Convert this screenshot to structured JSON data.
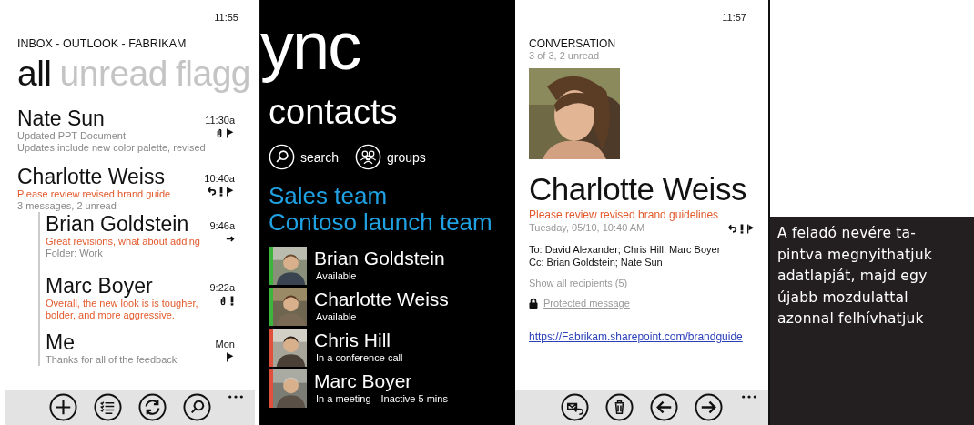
{
  "inbox": {
    "time": "11:55",
    "title": "INBOX - OUTLOOK - FABRIKAM",
    "pivots": [
      {
        "label": "all",
        "selected": true
      },
      {
        "label": "unread",
        "selected": false
      },
      {
        "label": "flagg",
        "selected": false
      }
    ],
    "messages": [
      {
        "sender": "Nate Sun",
        "time": "11:30a",
        "lines": [
          {
            "text": "Updated PPT Document",
            "unread": false
          },
          {
            "text": "Updates include new color palette, revised",
            "unread": false
          }
        ],
        "attachment": true,
        "important": false,
        "replied": false,
        "forwarded": false,
        "flagged": true
      },
      {
        "sender": "Charlotte Weiss",
        "time": "10:40a",
        "lines": [
          {
            "text": "Please review revised brand guide",
            "unread": true
          },
          {
            "text": "3 messages, 2 unread",
            "unread": false
          }
        ],
        "attachment": false,
        "important": true,
        "replied": true,
        "forwarded": false,
        "flagged": true,
        "children": [
          {
            "sender": "Brian Goldstein",
            "time": "9:46a",
            "lines": [
              {
                "text": "Great revisions, what about adding",
                "unread": true
              },
              {
                "text": "Folder: Work",
                "unread": false
              }
            ],
            "attachment": false,
            "important": false,
            "replied": false,
            "forwarded": true,
            "flagged": false
          },
          {
            "sender": "Marc Boyer",
            "time": "9:22a",
            "lines": [
              {
                "text": "Overall, the new look is is tougher,",
                "unread": true
              },
              {
                "text": "bolder, and more aggressive.",
                "unread": true
              }
            ],
            "attachment": true,
            "important": true,
            "replied": false,
            "forwarded": false,
            "flagged": false
          },
          {
            "sender": "Me",
            "time": "Mon",
            "lines": [
              {
                "text": "Thanks for all of the feedback",
                "unread": false
              }
            ],
            "attachment": false,
            "important": false,
            "replied": false,
            "forwarded": false,
            "flagged": true
          }
        ]
      }
    ],
    "app_bar": [
      {
        "kind": "add"
      },
      {
        "kind": "select"
      },
      {
        "kind": "sync"
      },
      {
        "kind": "search"
      }
    ]
  },
  "sync": {
    "app_title": "ync",
    "section": "contacts",
    "actions": [
      {
        "kind": "search",
        "label": "search"
      },
      {
        "kind": "groups",
        "label": "groups"
      }
    ],
    "groups": [
      "Sales team",
      "Contoso launch team"
    ],
    "contacts": [
      {
        "name": "Brian Goldstein",
        "status": "Available",
        "color": "#3db53d"
      },
      {
        "name": "Charlotte Weiss",
        "status": "Available",
        "color": "#3db53d"
      },
      {
        "name": "Chris Hill",
        "status": "In a conference call",
        "color": "#e0503c"
      },
      {
        "name": "Marc Boyer",
        "status": "In a meeting",
        "note": "Inactive 5 mins",
        "color": "#e0503c"
      }
    ]
  },
  "conversation": {
    "time": "11:57",
    "header": "CONVERSATION",
    "subheader": "3 of 3, 2 unread",
    "sender": "Charlotte Weiss",
    "subject": "Please review revised brand guidelines",
    "date": "Tuesday, 05/10, 10:40 AM",
    "replied": true,
    "important": true,
    "flagged": true,
    "to": "To: David Alexander; Chris Hill; Marc Boyer",
    "cc": "Cc: Brian Goldstein; Nate Sun",
    "show_all": "Show all recipients (5)",
    "protected": "Protected message",
    "link": "https://Fabrikam.sharepoint.com/brandguide",
    "app_bar": [
      {
        "kind": "reply"
      },
      {
        "kind": "delete"
      },
      {
        "kind": "back"
      },
      {
        "kind": "forward"
      }
    ]
  },
  "caption": {
    "lines": [
      "A feladó nevére ta-",
      "pintva megnyithatjuk",
      "adatlapját, majd egy",
      "újabb mozdulattal",
      "azonnal felhívhatjuk"
    ]
  }
}
